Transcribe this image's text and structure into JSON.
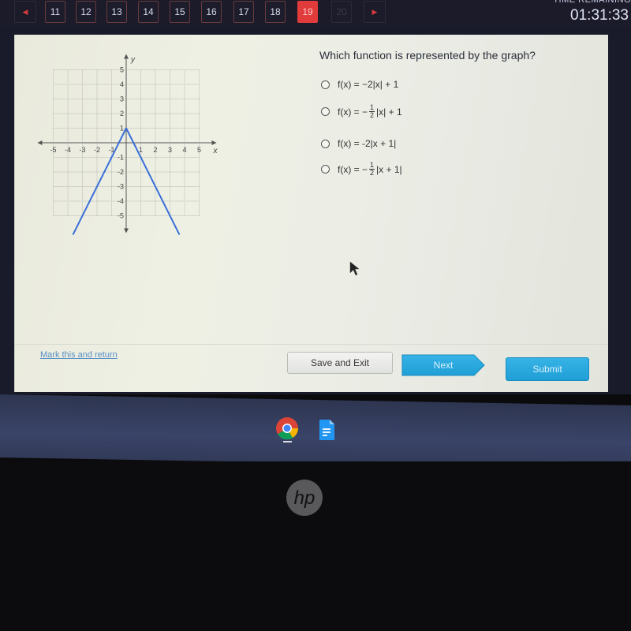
{
  "nav": {
    "prev_icon": "left-arrow-icon",
    "next_icon": "right-arrow-icon",
    "questions": [
      {
        "label": "11",
        "state": "answered"
      },
      {
        "label": "12",
        "state": "answered"
      },
      {
        "label": "13",
        "state": "answered"
      },
      {
        "label": "14",
        "state": "answered"
      },
      {
        "label": "15",
        "state": "answered"
      },
      {
        "label": "16",
        "state": "answered"
      },
      {
        "label": "17",
        "state": "answered"
      },
      {
        "label": "18",
        "state": "answered"
      },
      {
        "label": "19",
        "state": "current"
      },
      {
        "label": "20",
        "state": "disabled"
      }
    ],
    "time_label": "TIME REMAINING",
    "time_remaining": "01:31:33"
  },
  "question": {
    "prompt": "Which function is represented by the graph?",
    "options": [
      {
        "pre": "f(x) = −2|x| + 1",
        "frac": null,
        "post": ""
      },
      {
        "pre": "f(x) = −",
        "frac": {
          "num": "1",
          "den": "2"
        },
        "post": "|x| + 1"
      },
      {
        "pre": "f(x) = -2|x + 1|",
        "frac": null,
        "post": ""
      },
      {
        "pre": "f(x) = −",
        "frac": {
          "num": "1",
          "den": "2"
        },
        "post": "|x + 1|"
      }
    ],
    "selected": null
  },
  "graph": {
    "x_axis_label": "x",
    "y_axis_label": "y",
    "x_ticks": [
      "-5",
      "-4",
      "-3",
      "-2",
      "-1",
      "1",
      "2",
      "3",
      "4",
      "5"
    ],
    "y_ticks": [
      "5",
      "4",
      "3",
      "2",
      "1",
      "-1",
      "-2",
      "-3",
      "-4",
      "-5"
    ],
    "x_range": [
      -5,
      5
    ],
    "y_range": [
      -5,
      5
    ],
    "vertex": [
      0,
      1
    ],
    "slope_magnitude": 2,
    "line_color": "#3a6fd8"
  },
  "footer": {
    "mark_link": "Mark this and return",
    "save_exit": "Save and Exit",
    "next": "Next",
    "submit": "Submit"
  },
  "taskbar": {
    "apps": [
      "chrome-icon",
      "google-docs-icon"
    ]
  },
  "bezel": {
    "brand": "hp"
  },
  "colors": {
    "accent": "#2aa7dd",
    "current_question": "#e23b3b",
    "link": "#5a8fc4"
  }
}
